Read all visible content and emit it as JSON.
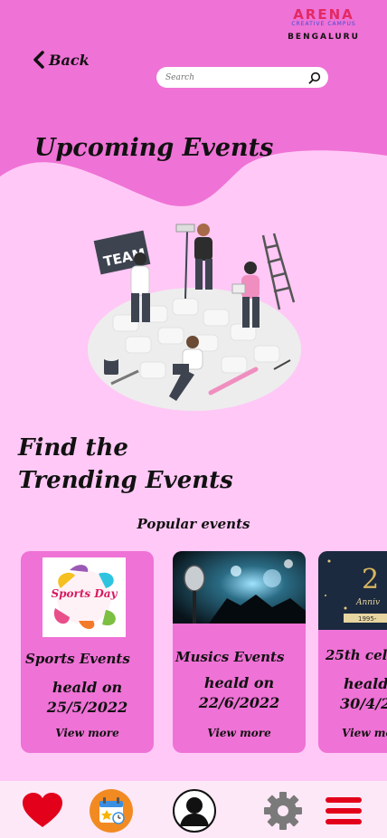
{
  "logo": {
    "brand": "ARENA",
    "tagline": "CREATIVE CAMPUS",
    "city": "BENGALURU"
  },
  "header": {
    "back_label": "Back",
    "search_placeholder": "Search",
    "title": "Upcoming Events"
  },
  "section": {
    "heading_line1": "Find the",
    "heading_line2": "Trending Events",
    "popular_label": "Popular events"
  },
  "events": [
    {
      "name": "Sports Events",
      "heald": "heald on",
      "date": "25/5/2022",
      "more": "View more",
      "image_text": "Sports Day"
    },
    {
      "name": "Musics Events",
      "heald": "heald on",
      "date": "22/6/2022",
      "more": "View more"
    },
    {
      "name": "25th cele",
      "heald": "heald",
      "date": "30/4/2",
      "more": "View mo",
      "image_text": "2",
      "image_sub": "Anniv",
      "image_years": "1995-"
    }
  ],
  "illustration": {
    "sign_text": "TEAM"
  },
  "tabbar": {
    "items": [
      "heart-icon",
      "calendar-icon",
      "profile-icon",
      "settings-icon",
      "menu-icon"
    ]
  },
  "colors": {
    "header_pink": "#ef72d6",
    "background": "#ffc8f6",
    "card": "#ef72d6",
    "tabbar": "#fde8f7"
  }
}
